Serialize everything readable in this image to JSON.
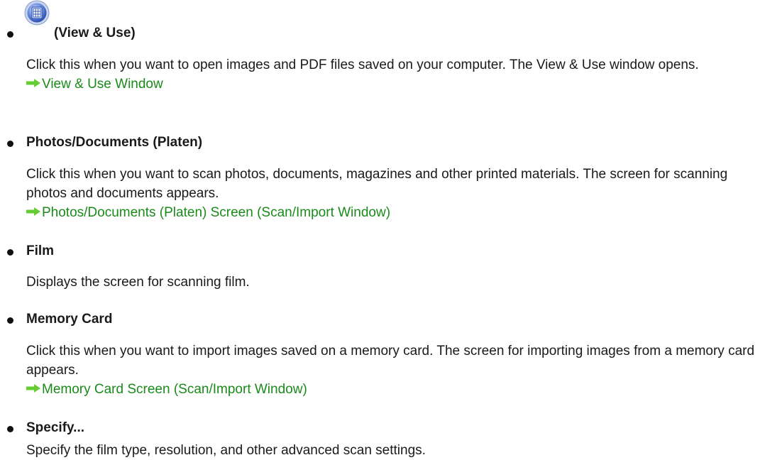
{
  "items": [
    {
      "title": "(View & Use)",
      "icon": "view-and-use-icon",
      "description": "Click this when you want to open images and PDF files saved on your computer. The View & Use window opens.",
      "link": "View & Use Window"
    },
    {
      "title": "Photos/Documents (Platen)",
      "description": "Click this when you want to scan photos, documents, magazines and other printed materials. The screen for scanning photos and documents appears.",
      "link": "Photos/Documents (Platen) Screen (Scan/Import Window)"
    },
    {
      "title": "Film",
      "description": "Displays the screen for scanning film."
    },
    {
      "title": "Memory Card",
      "description": "Click this when you want to import images saved on a memory card. The screen for importing images from a memory card appears.",
      "link": "Memory Card Screen (Scan/Import Window)"
    },
    {
      "title": "Specify...",
      "description": "Specify the film type, resolution, and other advanced scan settings."
    }
  ],
  "colors": {
    "link": "#1a8a1a",
    "arrow": "#66cc33"
  }
}
